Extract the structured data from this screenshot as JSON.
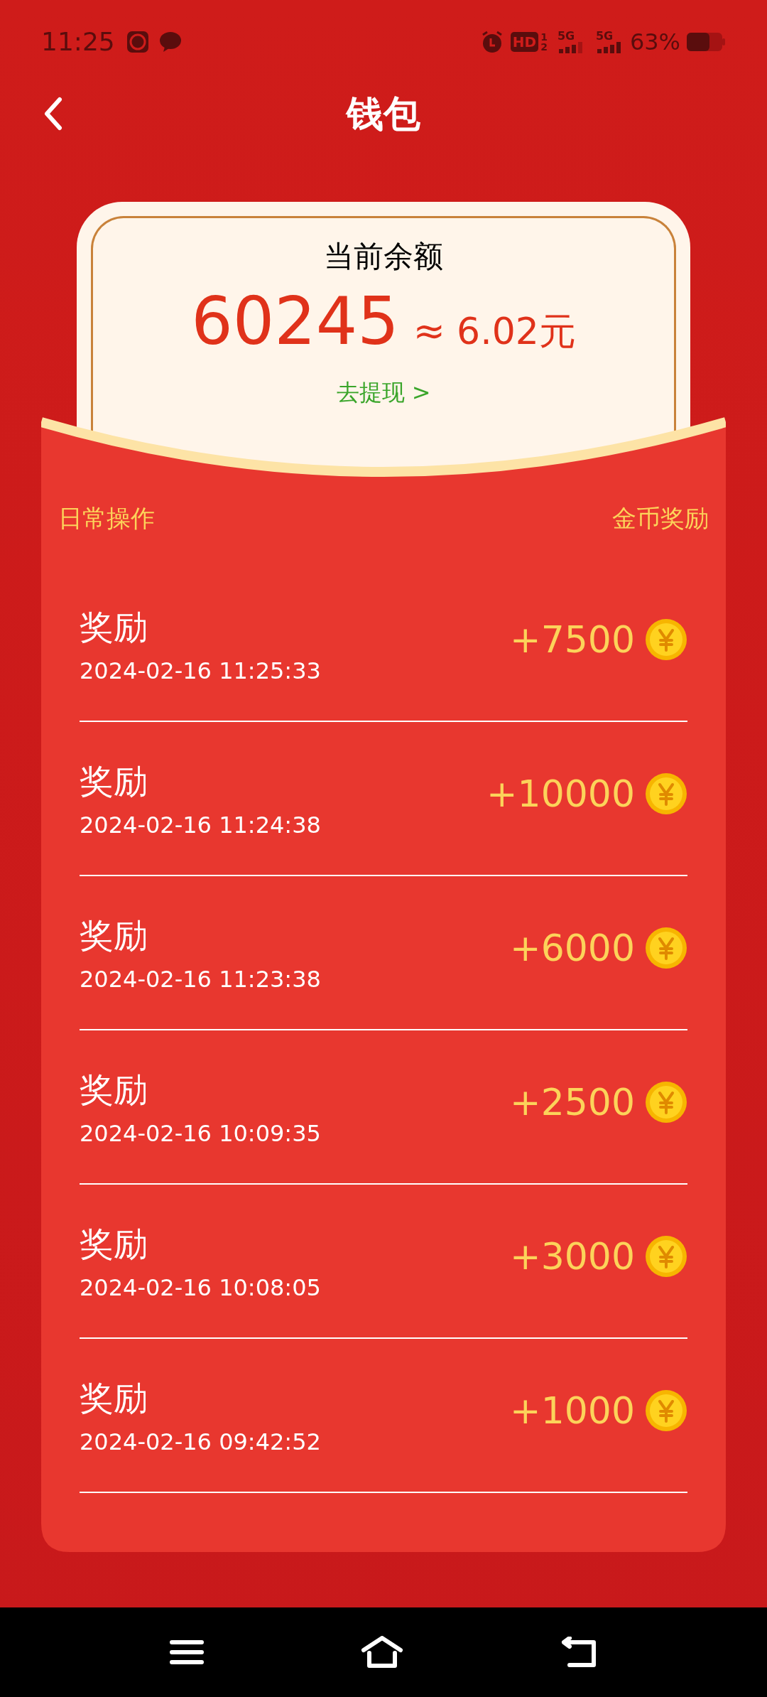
{
  "status_bar": {
    "time": "11:25",
    "hd": "HD",
    "hd_sub": [
      "1",
      "2"
    ],
    "networks": [
      "5G",
      "5G"
    ],
    "battery": "63%"
  },
  "header": {
    "title": "钱包"
  },
  "balance_card": {
    "label": "当前余额",
    "coins": "60245",
    "approx": "≈",
    "cash": "6.02元",
    "withdraw_link": "去提现 >"
  },
  "list_header": {
    "left": "日常操作",
    "right": "金币奖励"
  },
  "records": [
    {
      "title": "奖励",
      "time": "2024-02-16 11:25:33",
      "amount": "+7500"
    },
    {
      "title": "奖励",
      "time": "2024-02-16 11:24:38",
      "amount": "+10000"
    },
    {
      "title": "奖励",
      "time": "2024-02-16 11:23:38",
      "amount": "+6000"
    },
    {
      "title": "奖励",
      "time": "2024-02-16 10:09:35",
      "amount": "+2500"
    },
    {
      "title": "奖励",
      "time": "2024-02-16 10:08:05",
      "amount": "+3000"
    },
    {
      "title": "奖励",
      "time": "2024-02-16 09:42:52",
      "amount": "+1000"
    }
  ]
}
